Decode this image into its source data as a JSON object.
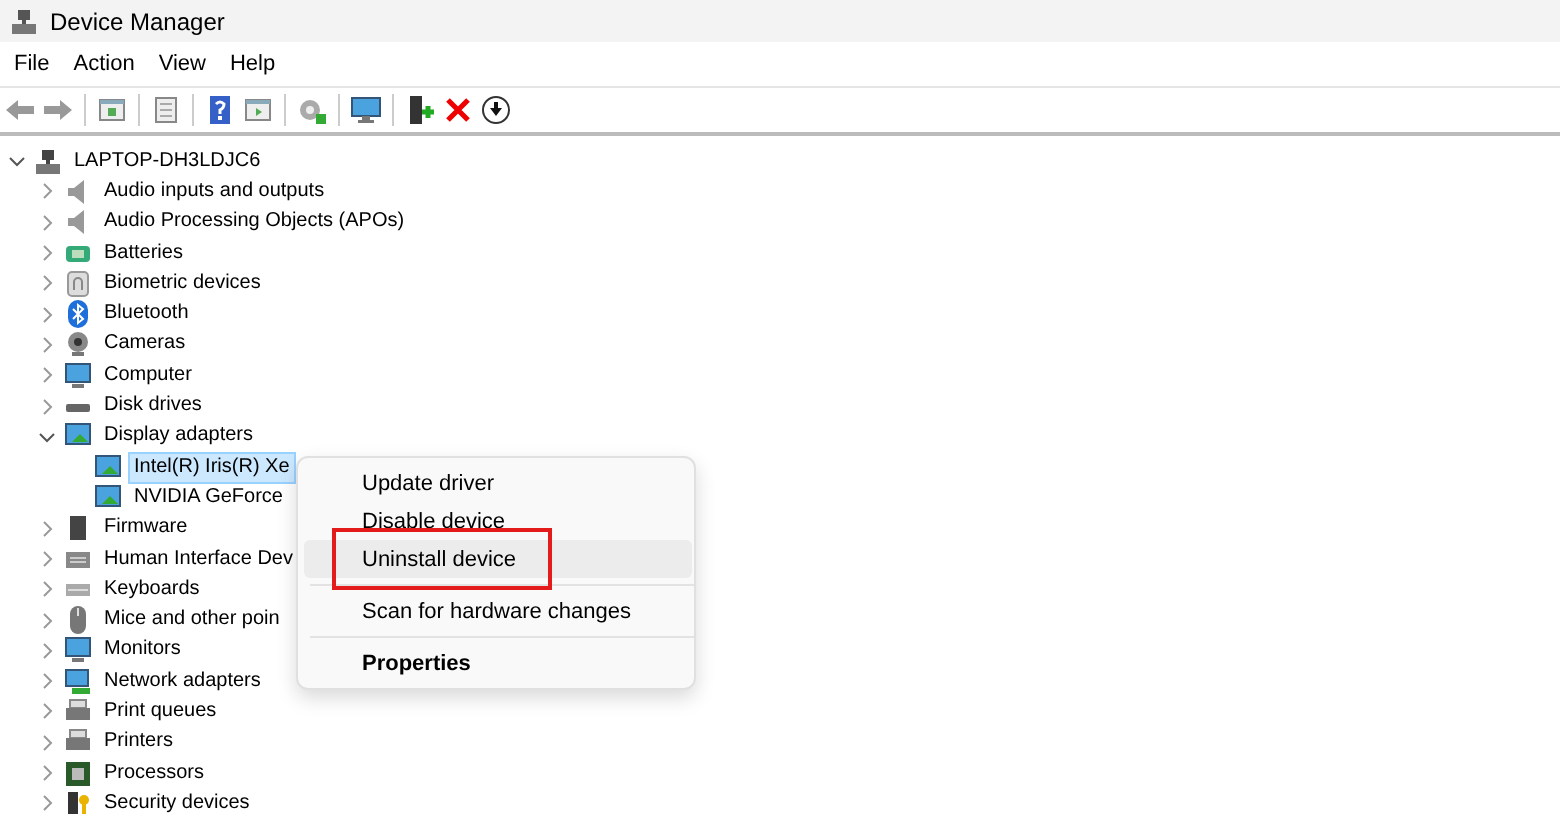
{
  "window": {
    "title": "Device Manager"
  },
  "menu_bar": [
    "File",
    "Action",
    "View",
    "Help"
  ],
  "tree": {
    "label": "LAPTOP-DH3LDJC6",
    "expanded": true,
    "selected": false,
    "children": [
      {
        "label": "Audio inputs and outputs",
        "expanded": false,
        "selected": false
      },
      {
        "label": "Audio Processing Objects (APOs)",
        "expanded": false,
        "selected": false
      },
      {
        "label": "Batteries",
        "expanded": false,
        "selected": false
      },
      {
        "label": "Biometric devices",
        "expanded": false,
        "selected": false
      },
      {
        "label": "Bluetooth",
        "expanded": false,
        "selected": false
      },
      {
        "label": "Cameras",
        "expanded": false,
        "selected": false
      },
      {
        "label": "Computer",
        "expanded": false,
        "selected": false
      },
      {
        "label": "Disk drives",
        "expanded": false,
        "selected": false
      },
      {
        "label": "Display adapters",
        "expanded": true,
        "selected": false,
        "children": [
          {
            "label": "Intel(R) Iris(R) Xe",
            "selected": true
          },
          {
            "label": "NVIDIA GeForce",
            "selected": false
          }
        ]
      },
      {
        "label": "Firmware",
        "expanded": false,
        "selected": false
      },
      {
        "label": "Human Interface Dev",
        "expanded": false,
        "selected": false
      },
      {
        "label": "Keyboards",
        "expanded": false,
        "selected": false
      },
      {
        "label": "Mice and other poin",
        "expanded": false,
        "selected": false
      },
      {
        "label": "Monitors",
        "expanded": false,
        "selected": false
      },
      {
        "label": "Network adapters",
        "expanded": false,
        "selected": false
      },
      {
        "label": "Print queues",
        "expanded": false,
        "selected": false
      },
      {
        "label": "Printers",
        "expanded": false,
        "selected": false
      },
      {
        "label": "Processors",
        "expanded": false,
        "selected": false
      },
      {
        "label": "Security devices",
        "expanded": false,
        "selected": false
      }
    ]
  },
  "context_menu": [
    {
      "label": "Update driver",
      "highlighted": false,
      "outlined": false,
      "default": false,
      "separator_before": false
    },
    {
      "label": "Disable device",
      "highlighted": false,
      "outlined": false,
      "default": false,
      "separator_before": false
    },
    {
      "label": "Uninstall device",
      "highlighted": true,
      "outlined": true,
      "default": false,
      "separator_before": false
    },
    {
      "label": "Scan for hardware changes",
      "highlighted": false,
      "outlined": false,
      "default": false,
      "separator_before": true
    },
    {
      "label": "Properties",
      "highlighted": false,
      "outlined": false,
      "default": true,
      "separator_before": true
    }
  ]
}
